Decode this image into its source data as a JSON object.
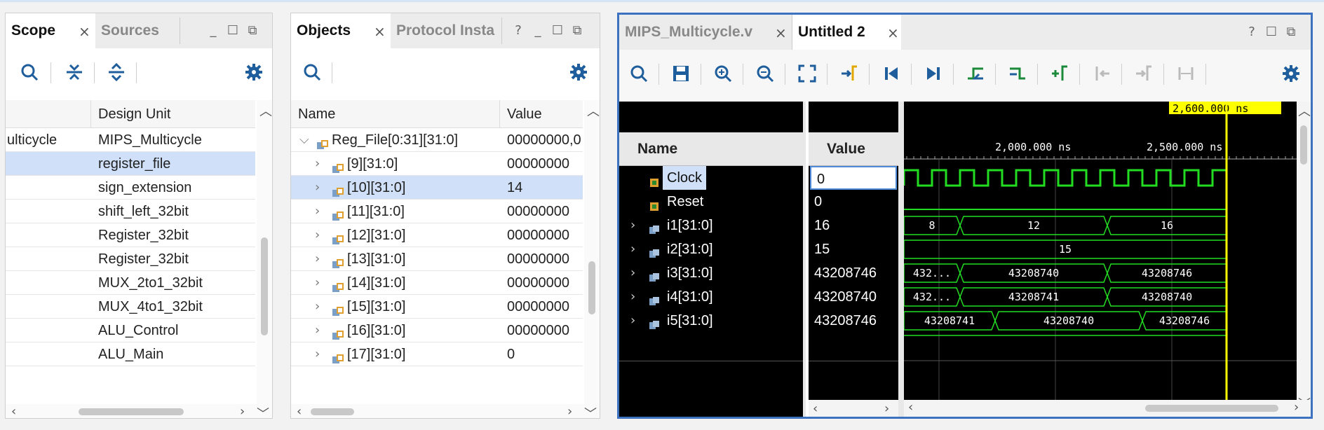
{
  "scope_panel": {
    "tabs": [
      "Scope",
      "Sources"
    ],
    "columns": [
      "",
      "Design Unit"
    ],
    "rows": [
      {
        "instance": "ulticycle",
        "unit": "MIPS_Multicycle"
      },
      {
        "instance": "",
        "unit": "register_file",
        "selected": true
      },
      {
        "instance": "",
        "unit": "sign_extension"
      },
      {
        "instance": "",
        "unit": "shift_left_32bit"
      },
      {
        "instance": "",
        "unit": "Register_32bit"
      },
      {
        "instance": "",
        "unit": "Register_32bit"
      },
      {
        "instance": "",
        "unit": "MUX_2to1_32bit"
      },
      {
        "instance": "",
        "unit": "MUX_4to1_32bit"
      },
      {
        "instance": "",
        "unit": "ALU_Control"
      },
      {
        "instance": "",
        "unit": "ALU_Main"
      }
    ]
  },
  "objects_panel": {
    "tabs": [
      "Objects",
      "Protocol Insta"
    ],
    "columns": [
      "Name",
      "Value"
    ],
    "rows": [
      {
        "name": "Reg_File[0:31][31:0]",
        "value": "00000000,0",
        "expanded": true
      },
      {
        "name": "[9][31:0]",
        "value": "00000000"
      },
      {
        "name": "[10][31:0]",
        "value": "14",
        "selected": true
      },
      {
        "name": "[11][31:0]",
        "value": "00000000"
      },
      {
        "name": "[12][31:0]",
        "value": "00000000"
      },
      {
        "name": "[13][31:0]",
        "value": "00000000"
      },
      {
        "name": "[14][31:0]",
        "value": "00000000"
      },
      {
        "name": "[15][31:0]",
        "value": "00000000"
      },
      {
        "name": "[16][31:0]",
        "value": "00000000"
      },
      {
        "name": "[17][31:0]",
        "value": "0"
      }
    ]
  },
  "wave_panel": {
    "tabs": [
      "MIPS_Multicycle.v",
      "Untitled 2"
    ],
    "columns": [
      "Name",
      "Value"
    ],
    "cursor_time": "2,600.000 ns",
    "time_ticks": [
      "2,000.000 ns",
      "2,500.000 ns"
    ],
    "signals": [
      {
        "name": "Clock",
        "value": "0",
        "type": "bit",
        "selected": true
      },
      {
        "name": "Reset",
        "value": "0",
        "type": "bit"
      },
      {
        "name": "i1[31:0]",
        "value": "16",
        "type": "bus"
      },
      {
        "name": "i2[31:0]",
        "value": "15",
        "type": "bus"
      },
      {
        "name": "i3[31:0]",
        "value": "43208746",
        "type": "bus"
      },
      {
        "name": "i4[31:0]",
        "value": "43208740",
        "type": "bus"
      },
      {
        "name": "i5[31:0]",
        "value": "43208746",
        "type": "bus"
      }
    ],
    "bus_segments": [
      [
        "8",
        "12",
        "16"
      ],
      [
        "15"
      ],
      [
        "432...",
        "43208740",
        "43208746"
      ],
      [
        "432...",
        "43208741",
        "43208740"
      ],
      [
        "43208741",
        "43208740",
        "43208746"
      ]
    ]
  },
  "colors": {
    "wave": "#22dd22",
    "cursor": "#ffff00",
    "selection": "#cfe0f8",
    "accent": "#2b6cc4"
  }
}
